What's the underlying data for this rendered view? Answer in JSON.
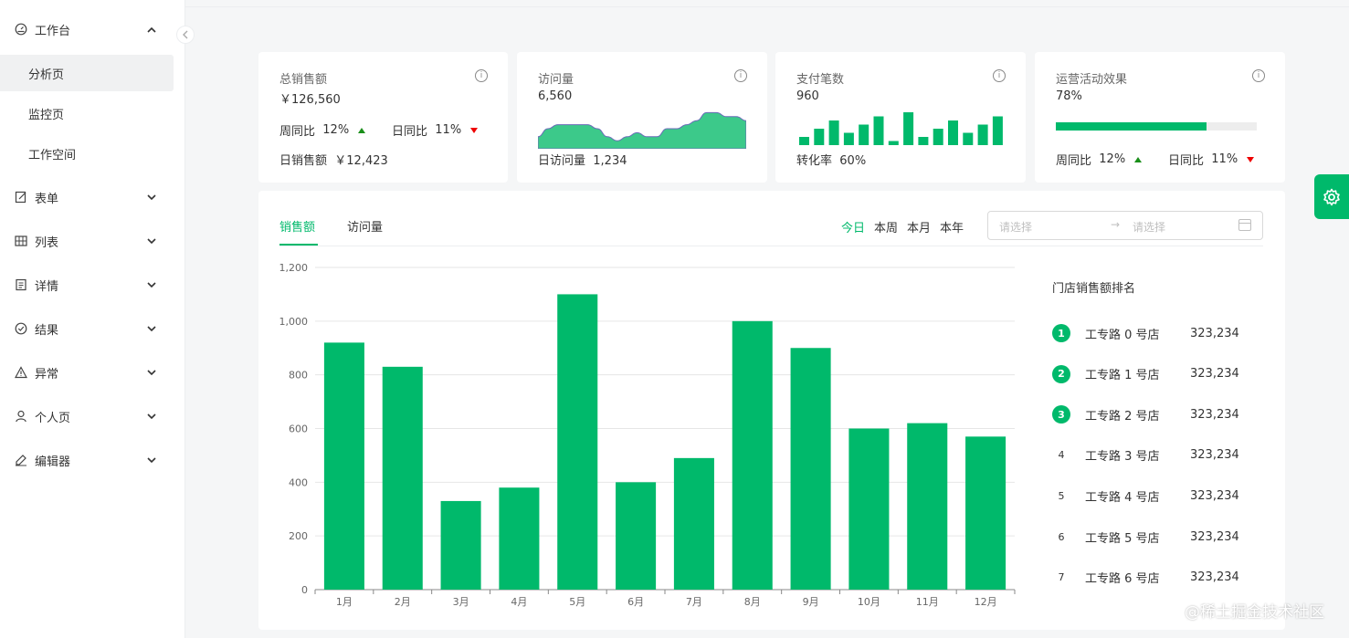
{
  "sidebar": {
    "items": [
      {
        "label": "工作台",
        "icon": "dashboard-icon",
        "expanded": true
      },
      {
        "label": "表单",
        "icon": "form-icon",
        "expanded": false
      },
      {
        "label": "列表",
        "icon": "table-icon",
        "expanded": false
      },
      {
        "label": "详情",
        "icon": "detail-icon",
        "expanded": false
      },
      {
        "label": "结果",
        "icon": "check-circle-icon",
        "expanded": false
      },
      {
        "label": "异常",
        "icon": "warning-icon",
        "expanded": false
      },
      {
        "label": "个人页",
        "icon": "user-icon",
        "expanded": false
      },
      {
        "label": "编辑器",
        "icon": "highlight-icon",
        "expanded": false
      }
    ],
    "subitems": [
      {
        "label": "分析页",
        "active": true
      },
      {
        "label": "监控页",
        "active": false
      },
      {
        "label": "工作空间",
        "active": false
      }
    ]
  },
  "cards": {
    "sales": {
      "title": "总销售额",
      "value": "￥126,560",
      "week_label": "周同比",
      "week_value": "12%",
      "day_label": "日同比",
      "day_value": "11%",
      "foot_label": "日销售额",
      "foot_value": "￥12,423"
    },
    "visits": {
      "title": "访问量",
      "value": "6,560",
      "foot_label": "日访问量",
      "foot_value": "1,234"
    },
    "payments": {
      "title": "支付笔数",
      "value": "960",
      "foot_label": "转化率",
      "foot_value": "60%"
    },
    "operations": {
      "title": "运营活动效果",
      "value": "78%",
      "progress": 0.75,
      "week_label": "周同比",
      "week_value": "12%",
      "day_label": "日同比",
      "day_value": "11%"
    }
  },
  "main": {
    "tabs": [
      "销售额",
      "访问量"
    ],
    "active_tab": 0,
    "ranges": [
      "今日",
      "本周",
      "本月",
      "本年"
    ],
    "active_range": 0,
    "date_start_placeholder": "请选择",
    "date_end_placeholder": "请选择",
    "ranking_title": "门店销售额排名",
    "ranking": [
      {
        "rank": "1",
        "name": "工专路 0 号店",
        "value": "323,234"
      },
      {
        "rank": "2",
        "name": "工专路 1 号店",
        "value": "323,234"
      },
      {
        "rank": "3",
        "name": "工专路 2 号店",
        "value": "323,234"
      },
      {
        "rank": "4",
        "name": "工专路 3 号店",
        "value": "323,234"
      },
      {
        "rank": "5",
        "name": "工专路 4 号店",
        "value": "323,234"
      },
      {
        "rank": "6",
        "name": "工专路 5 号店",
        "value": "323,234"
      },
      {
        "rank": "7",
        "name": "工专路 6 号店",
        "value": "323,234"
      }
    ]
  },
  "watermark": "@稀土掘金技术社区",
  "colors": {
    "accent": "#00b96b",
    "up": "#1a8f1a",
    "down": "#ee0000",
    "area": "#3cc98a"
  },
  "chart_data": [
    {
      "type": "bar",
      "title": "",
      "xlabel": "",
      "ylabel": "",
      "categories": [
        "1月",
        "2月",
        "3月",
        "4月",
        "5月",
        "6月",
        "7月",
        "8月",
        "9月",
        "10月",
        "11月",
        "12月"
      ],
      "values": [
        920,
        830,
        330,
        380,
        1100,
        400,
        490,
        1000,
        900,
        600,
        620,
        570
      ],
      "ylim": [
        0,
        1200
      ],
      "yticks": [
        "0",
        "200",
        "400",
        "600",
        "800",
        "1,000",
        "1,200"
      ],
      "grid": true
    },
    {
      "type": "area",
      "title": "",
      "values": [
        7,
        5,
        4,
        4,
        4,
        4,
        5,
        7,
        8,
        7,
        6,
        7,
        7,
        5,
        5,
        4,
        3,
        1,
        1,
        2,
        2,
        3
      ],
      "ylim": [
        0,
        10
      ],
      "grid": false
    },
    {
      "type": "bar",
      "title": "",
      "values": [
        2,
        4,
        6,
        3,
        5,
        7,
        1,
        8,
        2,
        4,
        6,
        3,
        5,
        7
      ],
      "ylim": [
        0,
        8
      ],
      "grid": false
    }
  ]
}
